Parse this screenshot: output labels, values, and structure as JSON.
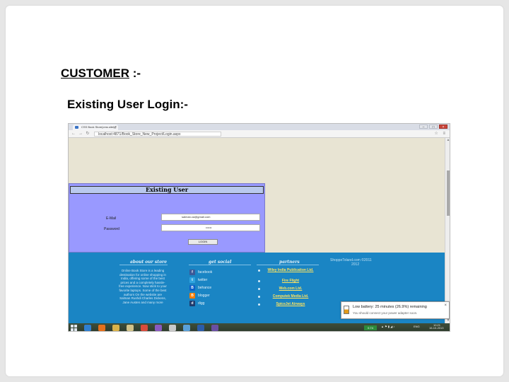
{
  "slide": {
    "heading": "CUSTOMER",
    "heading_suffix": " :-",
    "subheading": "Existing User Login:-"
  },
  "browser": {
    "tab_title": "CSS Book Store(cms.sitely)",
    "tab_close": "×",
    "window_buttons": {
      "minimize": "–",
      "maximize": "□",
      "close": "×"
    },
    "nav": {
      "back": "←",
      "forward": "→",
      "reload": "↻"
    },
    "url": "localhost:4871/Book_Store_New_Project/Login.aspx",
    "star": "☆",
    "menu": "≡"
  },
  "login": {
    "title": "Existing User",
    "email_label": "E-Mail",
    "email_value": "salman.ca@gmail.com",
    "password_label": "Password",
    "password_value": "••••••",
    "button": "LOGIN"
  },
  "footer": {
    "about_heading": "about our store",
    "social_heading": "get social",
    "partners_heading": "partners",
    "about_text": "Online Book Store is a leading destination for online shopping in India, offering some of the best prices and a completely hassle-free experience. Now stick to your favorite laptops. Some of the best authors On the website are Salman Rushdi Charles Dickens, Jane Austen and many more",
    "social": [
      {
        "label": "facebook",
        "icon": "f",
        "color": "#3b5998",
        "icon_name": "facebook-icon"
      },
      {
        "label": "twitter",
        "icon": "t",
        "color": "#2fa4e0",
        "icon_name": "twitter-icon"
      },
      {
        "label": "behance",
        "icon": "B",
        "color": "#0d5fc9",
        "icon_name": "behance-icon"
      },
      {
        "label": "blogger",
        "icon": "B",
        "color": "#f57d00",
        "icon_name": "blogger-icon"
      },
      {
        "label": "digg",
        "icon": "d",
        "color": "#1d3c6e",
        "icon_name": "digg-icon"
      }
    ],
    "partners": [
      "Wiley India Publication Ltd.",
      "Fire Flight",
      "Web.com Ltd.",
      "Computek Media Ltd.",
      "SpiceJet Airways"
    ],
    "copyright_line1": "ShoppeToland.com    ©2011",
    "copyright_line2": "2012"
  },
  "battery": {
    "title": "Low battery: 25 minutes (26.9%) remaining",
    "subtitle": "You should connect your power adapter soon.",
    "close": "×",
    "level": 0.269
  },
  "taskbar": {
    "apps": [
      {
        "name": "ie-taskbar-icon",
        "color": "#2f7fd0"
      },
      {
        "name": "firefox-taskbar-icon",
        "color": "#e6701c"
      },
      {
        "name": "explorer-taskbar-icon",
        "color": "#d9b24a"
      },
      {
        "name": "file-manager-taskbar-icon",
        "color": "#d2c38a"
      },
      {
        "name": "chrome-taskbar-icon",
        "color": "#d84b3c"
      },
      {
        "name": "media-taskbar-icon",
        "color": "#8a5ac0"
      },
      {
        "name": "mail-taskbar-icon",
        "color": "#c9c9c9"
      },
      {
        "name": "settings-taskbar-icon",
        "color": "#5aa0d8"
      },
      {
        "name": "word-taskbar-icon",
        "color": "#2b5ca8"
      },
      {
        "name": "visual-studio-taskbar-icon",
        "color": "#6a4fa3"
      }
    ],
    "battery_badge": "0.74",
    "language": "ENG",
    "time": "10:21",
    "date": "16-10-2013"
  }
}
